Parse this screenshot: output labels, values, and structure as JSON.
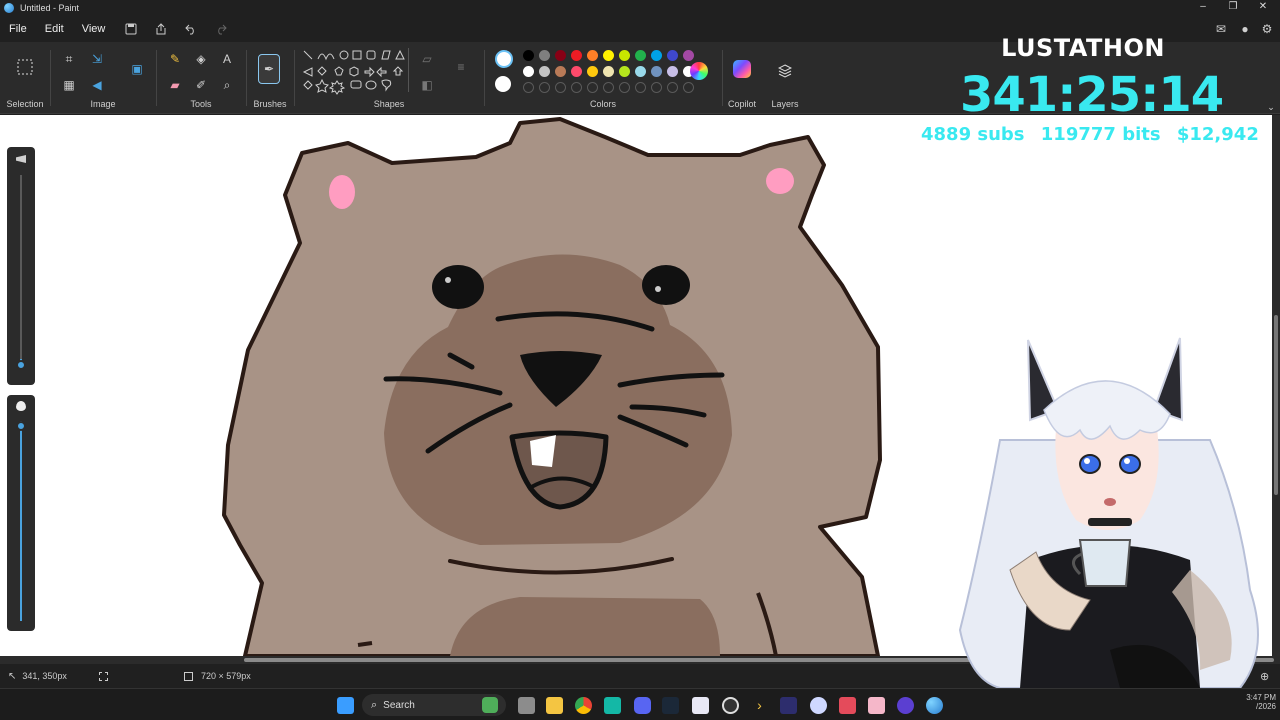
{
  "window": {
    "title": "Untitled - Paint",
    "minimize": "–",
    "maximize": "❐",
    "close": "✕"
  },
  "menu": {
    "file": "File",
    "edit": "Edit",
    "view": "View"
  },
  "ribbon": {
    "groups": {
      "selection": "Selection",
      "image": "Image",
      "tools": "Tools",
      "brushes": "Brushes",
      "shapes": "Shapes",
      "colors": "Colors",
      "copilot": "Copilot",
      "layers": "Layers"
    },
    "palette_row1": [
      "#000000",
      "#7f7f7f",
      "#880015",
      "#ed1c24",
      "#ff7f27",
      "#fff200",
      "#c8e600",
      "#22b14c",
      "#00a2e8",
      "#3f48cc",
      "#a349a4"
    ],
    "palette_row2": [
      "#ffffff",
      "#c3c3c3",
      "#b97a57",
      "#ff4a6b",
      "#ffc90e",
      "#efe4b0",
      "#b5e61d",
      "#99d9ea",
      "#7092be",
      "#c8bfe7",
      "#ffffff"
    ],
    "primary_color": "#ffffff",
    "secondary_color": "#ffffff"
  },
  "status": {
    "cursor": "341, 350px",
    "canvas_size": "720 × 579px"
  },
  "taskbar": {
    "search_placeholder": "Search",
    "clock_time": "3:47 PM",
    "clock_date": "/2026"
  },
  "overlay": {
    "title": "LUSTATHON",
    "timer": "341:25:14",
    "subs": "4889 subs",
    "bits": "119777 bits",
    "money": "$12,942"
  },
  "colors": {
    "accent": "#39e9f0",
    "slider": "#4aa3df",
    "fur": "#a89386",
    "muzzle": "#8a6e5f",
    "outline": "#2a1a14",
    "ear_pink": "#ff9dc1"
  }
}
